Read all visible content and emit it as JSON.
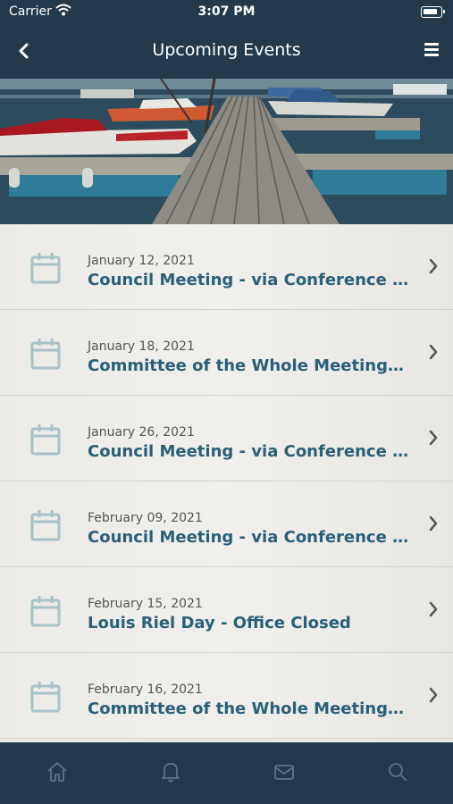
{
  "status": {
    "carrier": "Carrier",
    "time": "3:07 PM"
  },
  "nav": {
    "title": "Upcoming Events",
    "back_icon": "chevron-left-icon",
    "menu_icon": "hamburger-menu-icon"
  },
  "events": [
    {
      "date": "January 12, 2021",
      "title": "Council Meeting - via Conference Call"
    },
    {
      "date": "January 18, 2021",
      "title": "Committee of the Whole Meeting - via ..."
    },
    {
      "date": "January 26, 2021",
      "title": "Council Meeting - via Conference Call"
    },
    {
      "date": "February 09, 2021",
      "title": "Council Meeting - via Conference Call"
    },
    {
      "date": "February 15, 2021",
      "title": "Louis Riel Day - Office Closed"
    },
    {
      "date": "February 16, 2021",
      "title": "Committee of the Whole Meeting - via ..."
    }
  ],
  "tabs": [
    "home-icon",
    "bell-icon",
    "mail-icon",
    "search-icon"
  ],
  "colors": {
    "header": "#223a4c",
    "accent": "#2a5f78",
    "icon": "#a9c1c8"
  }
}
